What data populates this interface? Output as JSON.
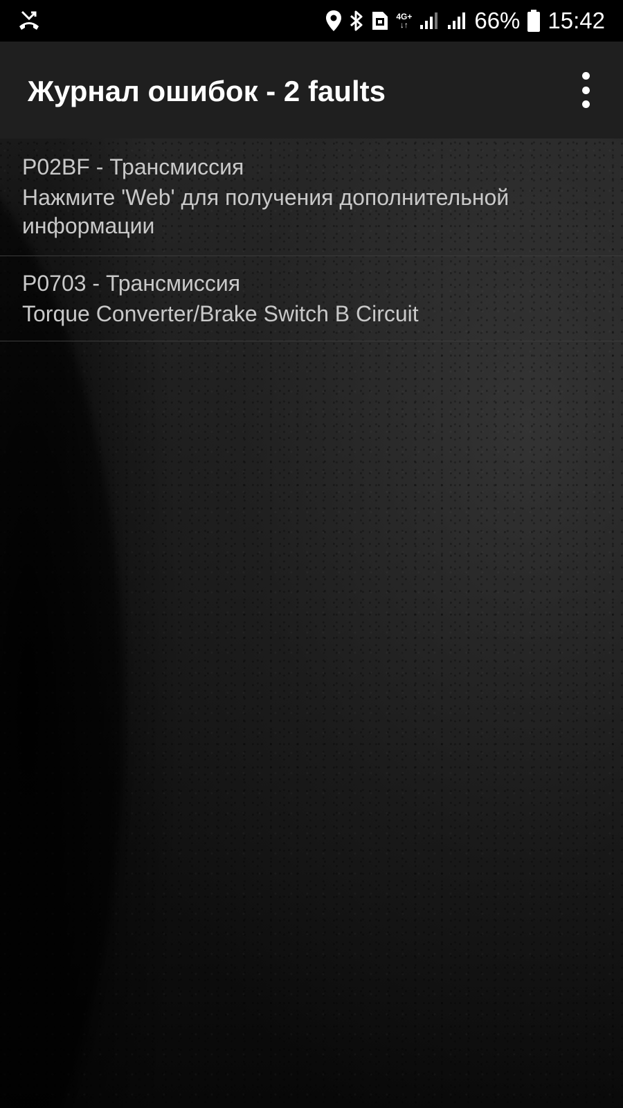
{
  "status_bar": {
    "left_icon": "missed-call-icon",
    "icons": [
      "location-icon",
      "bluetooth-icon",
      "sim-card-icon",
      "network-4g-icon",
      "signal-icon",
      "signal-icon",
      "battery-icon"
    ],
    "network_label_top": "4G+",
    "battery_percent": "66%",
    "clock": "15:42"
  },
  "header": {
    "title": "Журнал ошибок - 2 faults",
    "menu_icon": "overflow-menu-icon"
  },
  "faults": [
    {
      "title": "P02BF - Трансмиссия",
      "description": "Нажмите 'Web' для получения дополнительной информации"
    },
    {
      "title": "P0703 - Трансмиссия",
      "description": "Torque Converter/Brake Switch B Circuit"
    }
  ],
  "colors": {
    "status_bar_bg": "#000000",
    "action_bar_bg": "#1f1f1f",
    "text_primary": "#ffffff",
    "text_list": "#c9c9c9",
    "divider": "#3c3c3c"
  }
}
